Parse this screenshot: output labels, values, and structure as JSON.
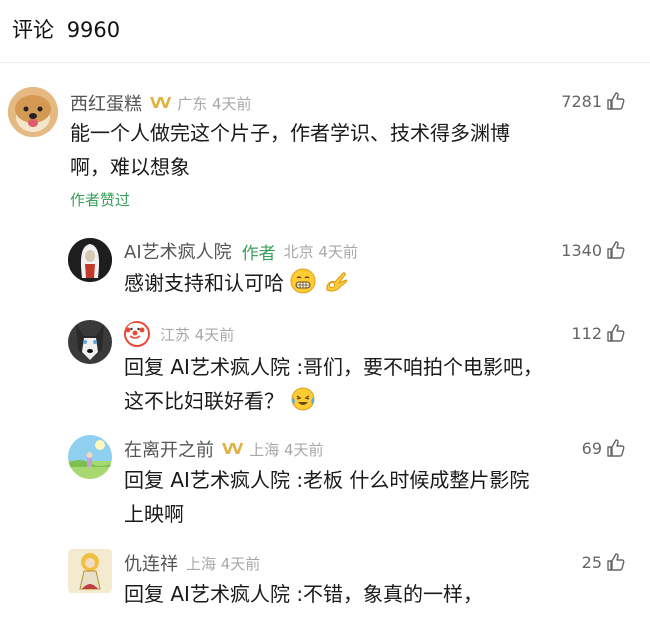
{
  "header": {
    "title": "评论",
    "count": "9960"
  },
  "comments": [
    {
      "name": "西红蛋糕",
      "badge": "VV",
      "location": "广东 4天前",
      "likes": "7281",
      "text_line1": "能一个人做完这个片子，作者学识、技术得多渊博",
      "text_line2": "啊，难以想象",
      "author_liked": "作者赞过"
    }
  ],
  "replies": [
    {
      "name": "AI艺术疯人院",
      "author_tag": "作者",
      "location": "北京 4天前",
      "likes": "1340",
      "text_line1": "感谢支持和认可哈"
    },
    {
      "name": "",
      "location": "江苏 4天前",
      "likes": "112",
      "reply_prefix": "回复",
      "reply_target": "AI艺术疯人院",
      "text_line1": ":哥们，要不咱拍个电影吧，",
      "text_line2": "这不比妇联好看？"
    },
    {
      "name": "在离开之前",
      "badge": "VV",
      "location": "上海 4天前",
      "likes": "69",
      "reply_prefix": "回复",
      "reply_target": "AI艺术疯人院",
      "text_line1": ":老板 什么时候成整片影院",
      "text_line2": "上映啊"
    },
    {
      "name": "仇连祥",
      "location": "上海 4天前",
      "likes": "25",
      "reply_prefix": "回复",
      "reply_target": "AI艺术疯人院",
      "text_line1": ":不错，象真的一样，"
    }
  ],
  "colors": {
    "author_green": "#3aa05a",
    "badge_gold": "#e0b040",
    "meta_gray": "#a8a8a8"
  },
  "icons": [
    "thumbs-up-icon",
    "vip-badge-icon",
    "clown-badge-icon",
    "grin-emoji",
    "ok-hand-emoji",
    "laughing-tears-emoji"
  ]
}
